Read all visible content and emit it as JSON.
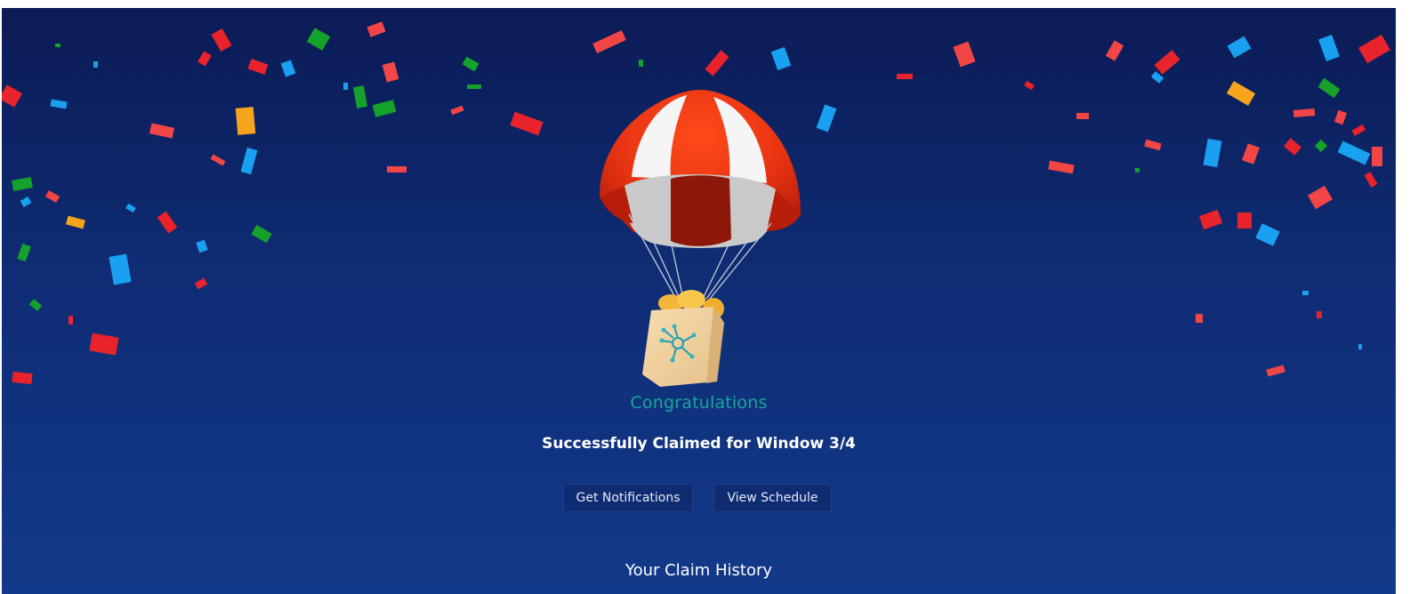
{
  "hero": {
    "title": "Congratulations",
    "subtitle": "Successfully Claimed for Window 3/4",
    "illustration": "parachute-airdrop-bag-icon"
  },
  "actions": {
    "notifications_label": "Get Notifications",
    "schedule_label": "View Schedule"
  },
  "history": {
    "heading": "Your Claim History"
  },
  "colors": {
    "background_top": "#0b1b55",
    "background_bottom": "#123a8a",
    "accent": "#16a89a",
    "confetti": [
      "#e8232b",
      "#f24646",
      "#15a22a",
      "#1aa0f0",
      "#f6a41b"
    ]
  }
}
